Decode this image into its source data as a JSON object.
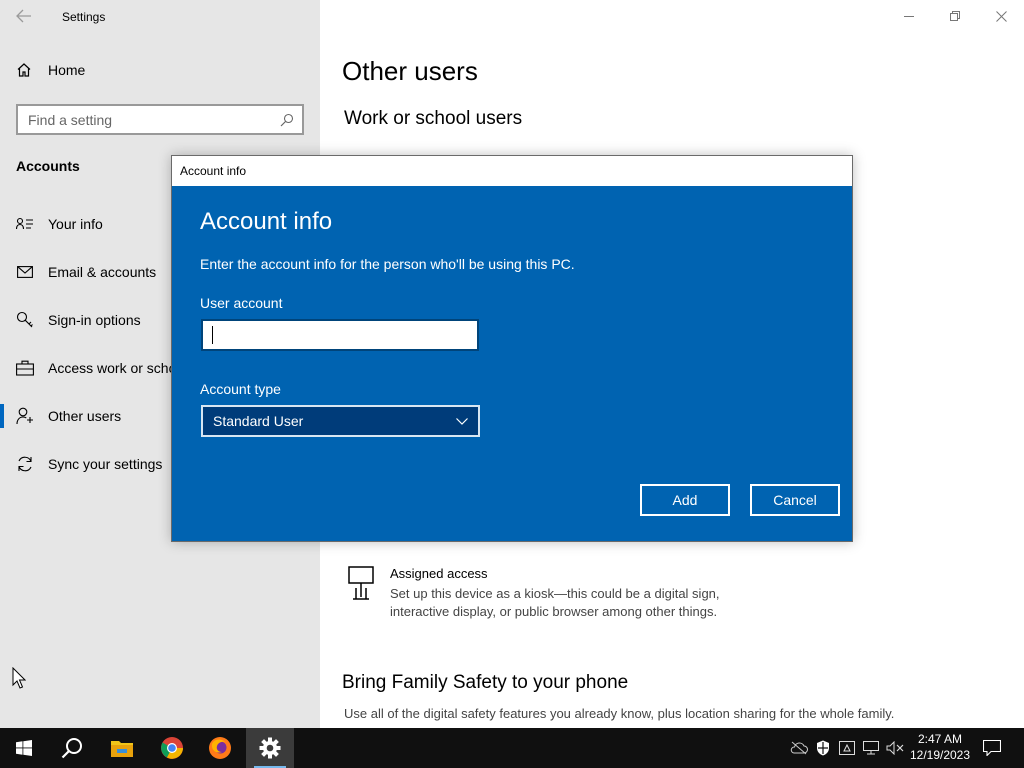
{
  "app": {
    "title": "Settings"
  },
  "nav": {
    "home": "Home",
    "search_placeholder": "Find a setting",
    "section": "Accounts",
    "items": [
      {
        "label": "Your info",
        "icon": "person-card-icon"
      },
      {
        "label": "Email & accounts",
        "icon": "mail-icon"
      },
      {
        "label": "Sign-in options",
        "icon": "key-icon"
      },
      {
        "label": "Access work or school",
        "icon": "briefcase-icon"
      },
      {
        "label": "Other users",
        "icon": "add-person-icon",
        "active": true
      },
      {
        "label": "Sync your settings",
        "icon": "sync-icon"
      }
    ]
  },
  "content": {
    "title": "Other users",
    "subtitle": "Work or school users",
    "assigned_title": "Assigned access",
    "assigned_desc": "Set up this device as a kiosk—this could be a digital sign, interactive display, or public browser among other things.",
    "family_title": "Bring Family Safety to your phone",
    "family_desc": "Use all of the digital safety features you already know, plus location sharing for the whole family."
  },
  "dialog": {
    "window_title": "Account info",
    "heading": "Account info",
    "description": "Enter the account info for the person who'll be using this PC.",
    "user_account_label": "User account",
    "user_account_value": "",
    "account_type_label": "Account type",
    "account_type_value": "Standard User",
    "add": "Add",
    "cancel": "Cancel",
    "bg_color": "#0063b1"
  },
  "taskbar": {
    "apps": [
      "start-icon",
      "search-icon",
      "file-explorer-icon",
      "chrome-icon",
      "firefox-icon",
      "settings-icon"
    ],
    "active_app": "settings-icon",
    "time": "2:47 AM",
    "date": "12/19/2023"
  }
}
